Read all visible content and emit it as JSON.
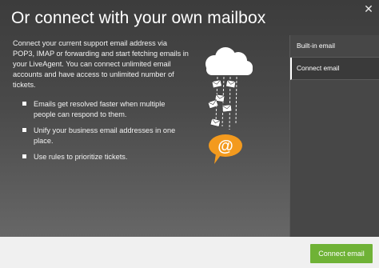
{
  "dialog": {
    "title": "Or connect with your own mailbox",
    "close_label": "✕"
  },
  "intro": {
    "text": "Connect your current support email address via POP3, IMAP or forwarding and start fetching emails in your LiveAgent. You can connect unlimited email accounts and have access to unlimited number of tickets."
  },
  "benefits": [
    {
      "text": "Emails get resolved faster when multiple people can respond to them."
    },
    {
      "text": "Unify your business email addresses in one place."
    },
    {
      "text": "Use rules to prioritize tickets."
    }
  ],
  "illustration": {
    "icon": "cloud-emails-at-icon",
    "bubble_symbol": "@",
    "accent_color": "#f39a1e"
  },
  "sidebar": {
    "items": [
      {
        "label": "Built-in email",
        "active": false
      },
      {
        "label": "Connect email",
        "active": true
      }
    ]
  },
  "footer": {
    "connect_label": "Connect email",
    "button_color": "#6fb236"
  }
}
